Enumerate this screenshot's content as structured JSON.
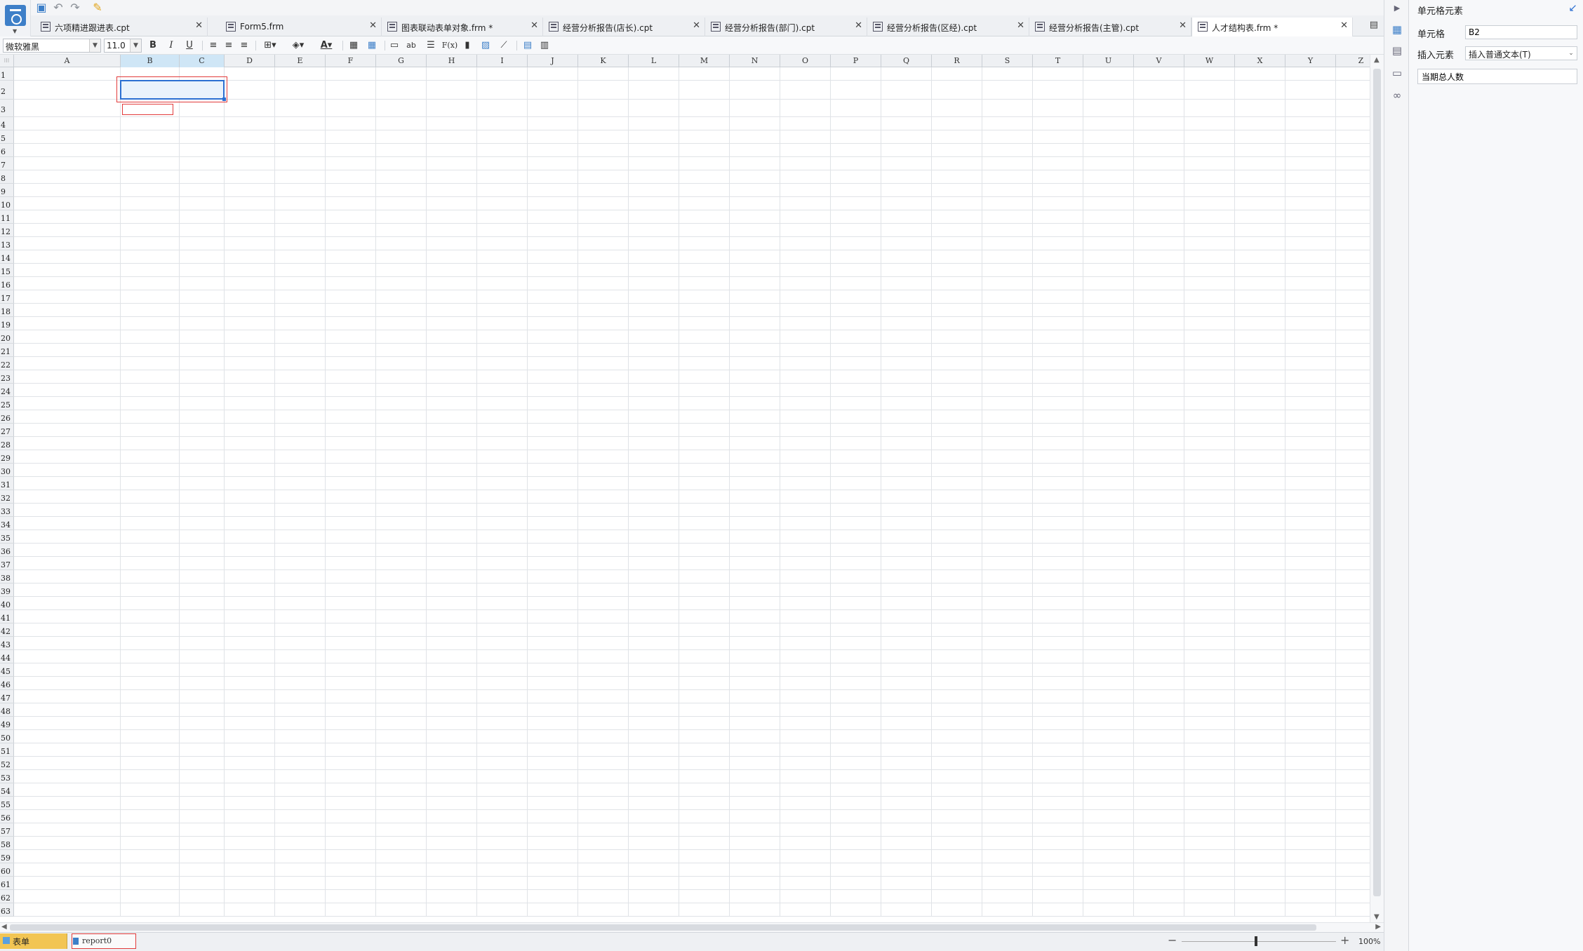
{
  "quickbar": {
    "save_icon": "save-icon",
    "undo_icon": "undo-icon",
    "redo_icon": "redo-icon",
    "format_painter_icon": "brush-icon"
  },
  "tabs": [
    {
      "label": "六项精进跟进表.cpt",
      "active": false
    },
    {
      "label": "Form5.frm",
      "active": false
    },
    {
      "label": "图表联动表单对象.frm *",
      "active": false
    },
    {
      "label": "经营分析报告(店长).cpt",
      "active": false
    },
    {
      "label": "经营分析报告(部门).cpt",
      "active": false
    },
    {
      "label": "经营分析报告(区经).cpt",
      "active": false
    },
    {
      "label": "经营分析报告(主管).cpt",
      "active": false
    },
    {
      "label": "人才结构表.frm *",
      "active": true
    }
  ],
  "toolbar": {
    "font_name": "微软雅黑",
    "font_size": "11.0",
    "bold": "B",
    "italic": "I",
    "underline": "U",
    "text_wrap": "ab",
    "formula": "F(x)"
  },
  "grid": {
    "columns": [
      "A",
      "B",
      "C",
      "D",
      "E",
      "F",
      "G",
      "H",
      "I",
      "J",
      "K",
      "L",
      "M",
      "N",
      "O",
      "P",
      "Q",
      "R",
      "S",
      "T",
      "U",
      "V",
      "W",
      "X",
      "Y",
      "Z"
    ],
    "selected_columns": [
      "B",
      "C"
    ],
    "row_count": 63,
    "selected_cell": "B2"
  },
  "sheet_tabs": {
    "form_label": "表单",
    "report_label": "report0"
  },
  "zoom": {
    "minus": "−",
    "plus": "+",
    "level": "100%",
    "fraction": 0.5
  },
  "panel": {
    "title": "单元格元素",
    "cell_label": "单元格",
    "cell_value": "B2",
    "insert_label": "插入元素",
    "insert_value": "插入普通文本(T)",
    "text_value": "当期总人数"
  }
}
